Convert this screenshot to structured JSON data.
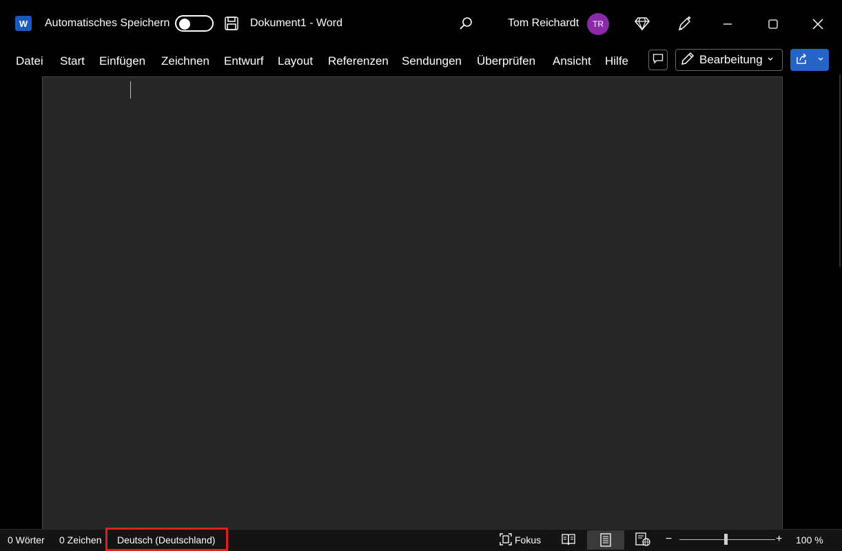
{
  "titlebar": {
    "app_icon_letter": "W",
    "autosave_label": "Automatisches Speichern",
    "autosave_on": false,
    "document_title": "Dokument1  -  Word",
    "user_name": "Tom Reichardt",
    "user_initials": "TR",
    "avatar_color": "#8a2aa8"
  },
  "menu": {
    "items": [
      "Datei",
      "Start",
      "Einfügen",
      "Zeichnen",
      "Entwurf",
      "Layout",
      "Referenzen",
      "Sendungen",
      "Überprüfen",
      "Ansicht",
      "Hilfe"
    ],
    "editing_label": "Bearbeitung",
    "share_color": "#2563c7"
  },
  "statusbar": {
    "word_count": "0 Wörter",
    "char_count": "0 Zeichen",
    "language": "Deutsch (Deutschland)",
    "focus_label": "Fokus",
    "zoom_minus": "−",
    "zoom_plus": "+",
    "zoom_level": "100 %",
    "highlight_color": "#e02020"
  },
  "icons": [
    "word-app-icon",
    "save-icon",
    "search-icon",
    "diamond-icon",
    "designer-pen-icon",
    "minimize-icon",
    "maximize-icon",
    "close-icon",
    "comment-icon",
    "pencil-icon",
    "share-icon",
    "focus-icon",
    "read-mode-icon",
    "print-layout-icon",
    "web-layout-icon"
  ]
}
